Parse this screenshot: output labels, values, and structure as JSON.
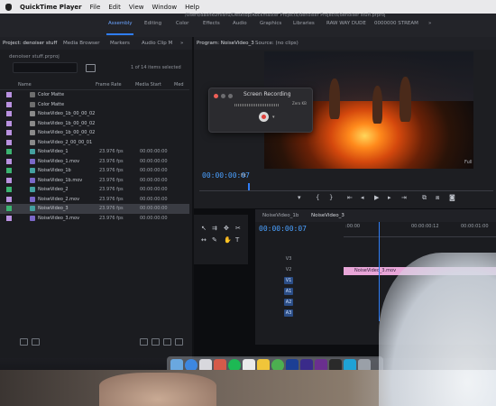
{
  "menubar": {
    "app_name": "QuickTime Player",
    "items": [
      "File",
      "Edit",
      "View",
      "Window",
      "Help"
    ]
  },
  "premiere": {
    "path": "/Users/dashkumishu/Desktop/Rockmaster Projects/denoiser Projects/denoiser stuff.prproj",
    "workspaces": [
      "Assembly",
      "Editing",
      "Color",
      "Effects",
      "Audio",
      "Graphics",
      "Libraries",
      "RAW WAY DUDE",
      "0000000 STREAM"
    ],
    "active_workspace": "Assembly",
    "more": "»"
  },
  "project": {
    "tabs": [
      "Project: denoiser stuff",
      "Media Browser",
      "Markers",
      "Audio Clip M"
    ],
    "tabs_more": "»",
    "file": "denoiser stuff.prproj",
    "count": "1 of 14 items selected",
    "columns": [
      "Name",
      "Frame Rate",
      "Media Start",
      "Med"
    ],
    "items": [
      {
        "name": "Color Matte",
        "fps": "",
        "start": "",
        "chip": "#b991e0",
        "ico": "#6e6e6e"
      },
      {
        "name": "Color Matte",
        "fps": "",
        "start": "",
        "chip": "#b991e0",
        "ico": "#6e6e6e"
      },
      {
        "name": "NoiseVideo_1b_00_00_02",
        "fps": "",
        "start": "",
        "chip": "#b991e0",
        "ico": "#8a8a8a"
      },
      {
        "name": "NoiseVideo_1b_00_00_02",
        "fps": "",
        "start": "",
        "chip": "#b991e0",
        "ico": "#8a8a8a"
      },
      {
        "name": "NoiseVideo_1b_00_00_02",
        "fps": "",
        "start": "",
        "chip": "#b991e0",
        "ico": "#8a8a8a"
      },
      {
        "name": "NoiseVideo_2_00_00_01",
        "fps": "",
        "start": "",
        "chip": "#b991e0",
        "ico": "#8a8a8a"
      },
      {
        "name": "NoiseVideo_1",
        "fps": "23.976 fps",
        "start": "00:00:00:00",
        "chip": "#3cb371",
        "ico": "#44a0a0"
      },
      {
        "name": "NoiseVideo_1.mov",
        "fps": "23.976 fps",
        "start": "00:00:00:00",
        "chip": "#b991e0",
        "ico": "#7b68c8"
      },
      {
        "name": "NoiseVideo_1b",
        "fps": "23.976 fps",
        "start": "00:00:00:00",
        "chip": "#3cb371",
        "ico": "#44a0a0"
      },
      {
        "name": "NoiseVideo_1b.mov",
        "fps": "23.976 fps",
        "start": "00:00:00:00",
        "chip": "#b991e0",
        "ico": "#7b68c8"
      },
      {
        "name": "NoiseVideo_2",
        "fps": "23.976 fps",
        "start": "00:00:00:00",
        "chip": "#3cb371",
        "ico": "#44a0a0"
      },
      {
        "name": "NoiseVideo_2.mov",
        "fps": "23.976 fps",
        "start": "00:00:00:00",
        "chip": "#b991e0",
        "ico": "#7b68c8"
      },
      {
        "name": "NoiseVideo_3",
        "fps": "23.976 fps",
        "start": "00:00:00:00",
        "chip": "#3cb371",
        "ico": "#44a0a0"
      },
      {
        "name": "NoiseVideo_3.mov",
        "fps": "23.976 fps",
        "start": "00:00:00:00",
        "chip": "#b991e0",
        "ico": "#7b68c8"
      }
    ],
    "selected_index": 12
  },
  "program": {
    "tab": "Program: NoiseVideo_3",
    "source_tab": "Source: (no clips)",
    "timecode": "00:00:00:07",
    "fit": "Fit",
    "resolution": "Full"
  },
  "recording": {
    "title": "Screen Recording",
    "level": "Zero KB"
  },
  "timeline": {
    "tabs": [
      "NoiseVideo_1b",
      "NoiseVideo_3"
    ],
    "timecode": "00:00:00:07",
    "ruler": [
      ":00:00",
      "00:00:00:12",
      "00:00:01:00"
    ],
    "tracks": [
      "V3",
      "V2",
      "V1",
      "A1",
      "A2",
      "A3"
    ],
    "clip_name": "NoiseVideo_3.mov"
  },
  "colors": {
    "accent": "#2f7df6",
    "timecode": "#4aa0ff",
    "clip": "#e8a6d8"
  }
}
